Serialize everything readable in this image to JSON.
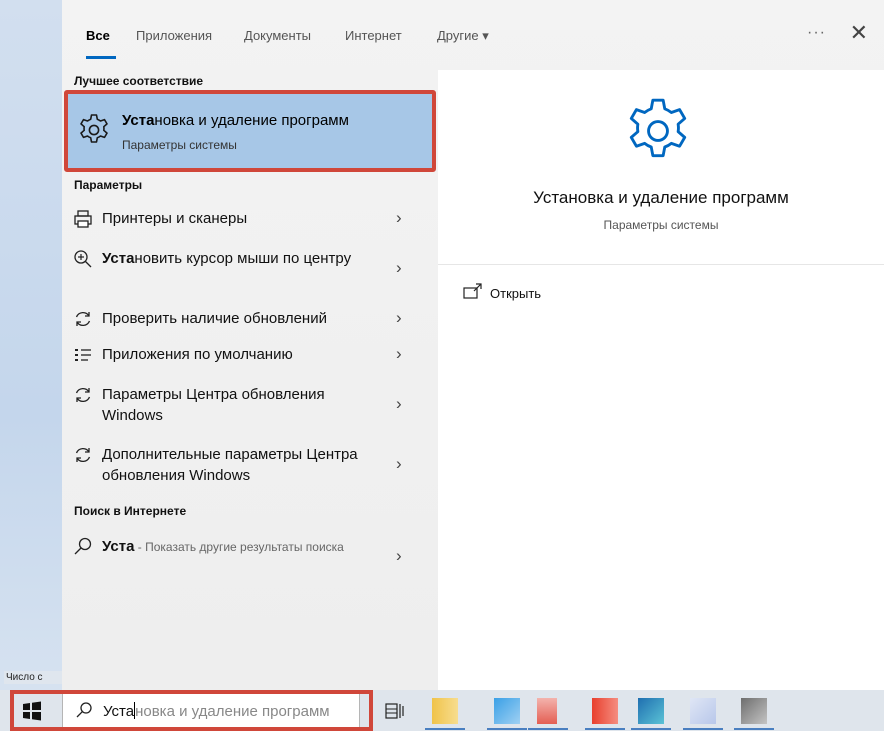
{
  "tabs": [
    {
      "label": "Все",
      "active": true
    },
    {
      "label": "Приложения"
    },
    {
      "label": "Документы"
    },
    {
      "label": "Интернет"
    },
    {
      "label": "Другие ▾"
    }
  ],
  "more_label": "···",
  "close_label": "✕",
  "best_match": {
    "header": "Лучшее соответствие",
    "title_bold": "Уста",
    "title_rest": "новка и удаление программ",
    "subtitle": "Параметры системы",
    "icon": "gear-icon"
  },
  "settings": {
    "header": "Параметры",
    "items": [
      {
        "bold": "",
        "rest": "Принтеры и сканеры",
        "icon": "printer-icon"
      },
      {
        "bold": "Уста",
        "rest": "новить курсор мыши по центру",
        "icon": "zoom-icon"
      },
      {
        "bold": "",
        "rest": "Проверить наличие обновлений",
        "icon": "refresh-icon"
      },
      {
        "bold": "",
        "rest": "Приложения по умолчанию",
        "icon": "list-icon"
      },
      {
        "bold": "",
        "rest": "Параметры Центра обновления Windows",
        "icon": "refresh-icon"
      },
      {
        "bold": "",
        "rest": "Дополнительные параметры Центра обновления Windows",
        "icon": "refresh-icon"
      }
    ]
  },
  "web": {
    "header": "Поиск в Интернете",
    "query": "Уста",
    "rest": " - Показать другие результаты поиска",
    "icon": "search-icon"
  },
  "preview": {
    "title": "Установка и удаление программ",
    "subtitle": "Параметры системы",
    "action_open": "Открыть"
  },
  "taskbar": {
    "search_typed": "Уста",
    "search_ghost": "новка и удаление программ"
  },
  "status_snippet": "Число с",
  "colors": {
    "accent": "#0067c0",
    "highlight": "#a7c7e7",
    "annotation": "#d0473a"
  }
}
